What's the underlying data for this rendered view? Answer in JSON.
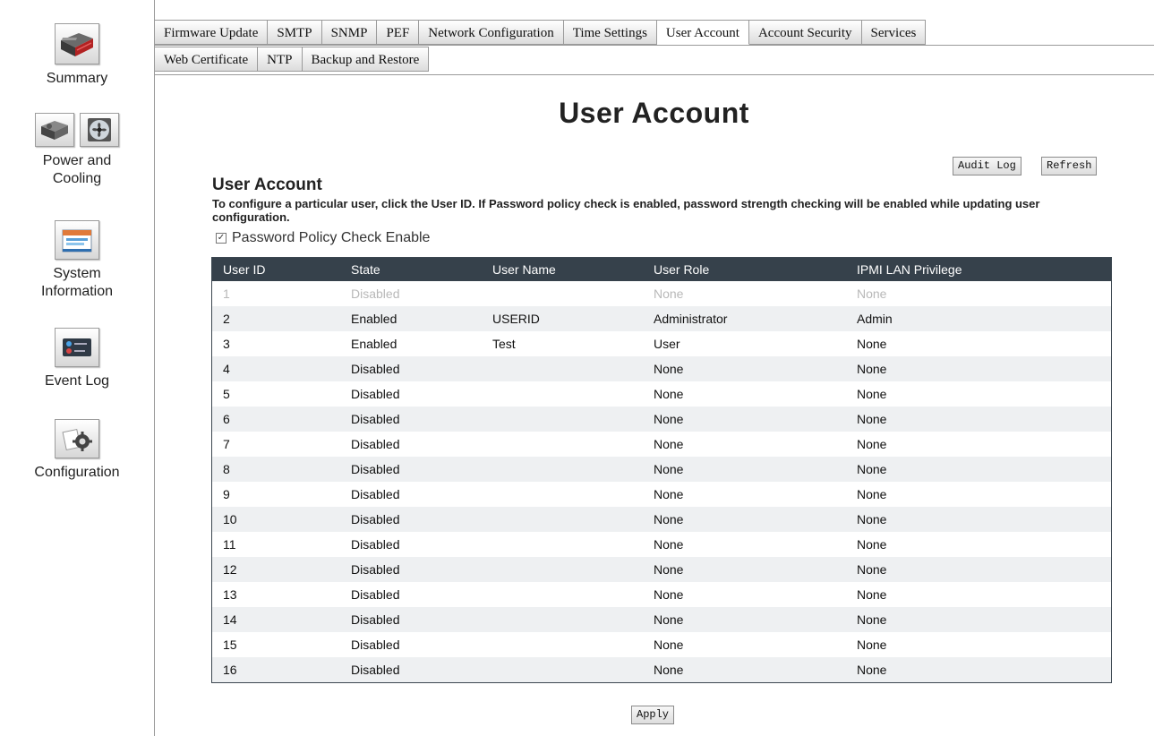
{
  "nav": {
    "summary": "Summary",
    "power": "Power and Cooling",
    "system": "System Information",
    "eventlog": "Event Log",
    "configuration": "Configuration"
  },
  "tabs_row1": [
    "Firmware Update",
    "SMTP",
    "SNMP",
    "PEF",
    "Network Configuration",
    "Time Settings",
    "User Account",
    "Account Security",
    "Services"
  ],
  "tabs_row2": [
    "Web Certificate",
    "NTP",
    "Backup and Restore"
  ],
  "active_tab": "User Account",
  "page": {
    "title": "User Account",
    "audit_log_button": "Audit Log",
    "refresh_button": "Refresh",
    "section_title": "User Account",
    "description": "To configure a particular user, click the User ID. If Password policy check is enabled, password strength checking will be enabled while updating user configuration.",
    "policy_checkbox_label": "Password Policy Check Enable",
    "policy_checked": true,
    "apply_button": "Apply"
  },
  "table": {
    "headers": [
      "User ID",
      "State",
      "User Name",
      "User Role",
      "IPMI LAN Privilege"
    ],
    "rows": [
      [
        "1",
        "Disabled",
        "",
        "None",
        "None"
      ],
      [
        "2",
        "Enabled",
        "USERID",
        "Administrator",
        "Admin"
      ],
      [
        "3",
        "Enabled",
        "Test",
        "User",
        "None"
      ],
      [
        "4",
        "Disabled",
        "",
        "None",
        "None"
      ],
      [
        "5",
        "Disabled",
        "",
        "None",
        "None"
      ],
      [
        "6",
        "Disabled",
        "",
        "None",
        "None"
      ],
      [
        "7",
        "Disabled",
        "",
        "None",
        "None"
      ],
      [
        "8",
        "Disabled",
        "",
        "None",
        "None"
      ],
      [
        "9",
        "Disabled",
        "",
        "None",
        "None"
      ],
      [
        "10",
        "Disabled",
        "",
        "None",
        "None"
      ],
      [
        "11",
        "Disabled",
        "",
        "None",
        "None"
      ],
      [
        "12",
        "Disabled",
        "",
        "None",
        "None"
      ],
      [
        "13",
        "Disabled",
        "",
        "None",
        "None"
      ],
      [
        "14",
        "Disabled",
        "",
        "None",
        "None"
      ],
      [
        "15",
        "Disabled",
        "",
        "None",
        "None"
      ],
      [
        "16",
        "Disabled",
        "",
        "None",
        "None"
      ]
    ],
    "greyed_rows": [
      0
    ]
  },
  "colors": {
    "table_header_bg": "#36414b",
    "alt_row_bg": "#eef0f2",
    "greyed_text": "#b8b8b8"
  },
  "icons": [
    "server-icon",
    "power-supply-icon",
    "fan-icon",
    "calendar-icon",
    "event-log-icon",
    "gears-icon",
    "checkmark-icon"
  ]
}
